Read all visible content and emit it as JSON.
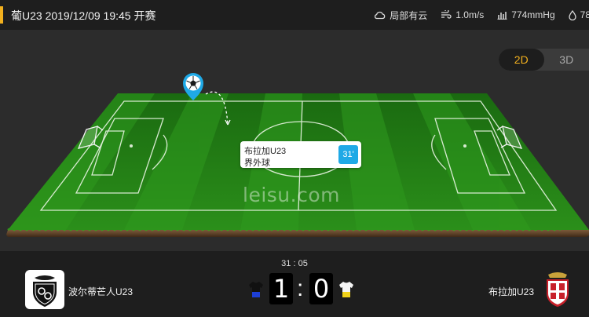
{
  "header": {
    "match_title": "葡U23 2019/12/09 19:45 开赛",
    "accent_color": "#f2b01e"
  },
  "weather": {
    "condition": "局部有云",
    "condition_icon": "cloud-icon",
    "wind": "1.0m/s",
    "wind_icon": "wind-icon",
    "pressure": "774mmHg",
    "pressure_icon": "pressure-icon",
    "humidity": "78",
    "humidity_icon": "humidity-drop-icon"
  },
  "view_toggle": {
    "options": [
      "2D",
      "3D"
    ],
    "selected": "2D"
  },
  "event": {
    "team": "布拉加U23",
    "type": "界外球",
    "minute": "31'",
    "marker_icon": "soccer-ball-marker-icon"
  },
  "watermark": "leisu.com",
  "match": {
    "clock": "31 : 05",
    "home_team": "波尔蒂芒人U23",
    "away_team": "布拉加U23",
    "home_score": "1",
    "away_score": "0",
    "home_kit_colors": [
      "#111111",
      "#1d3fd6"
    ],
    "away_kit_colors": [
      "#f4f4f4",
      "#f1d21a"
    ]
  }
}
